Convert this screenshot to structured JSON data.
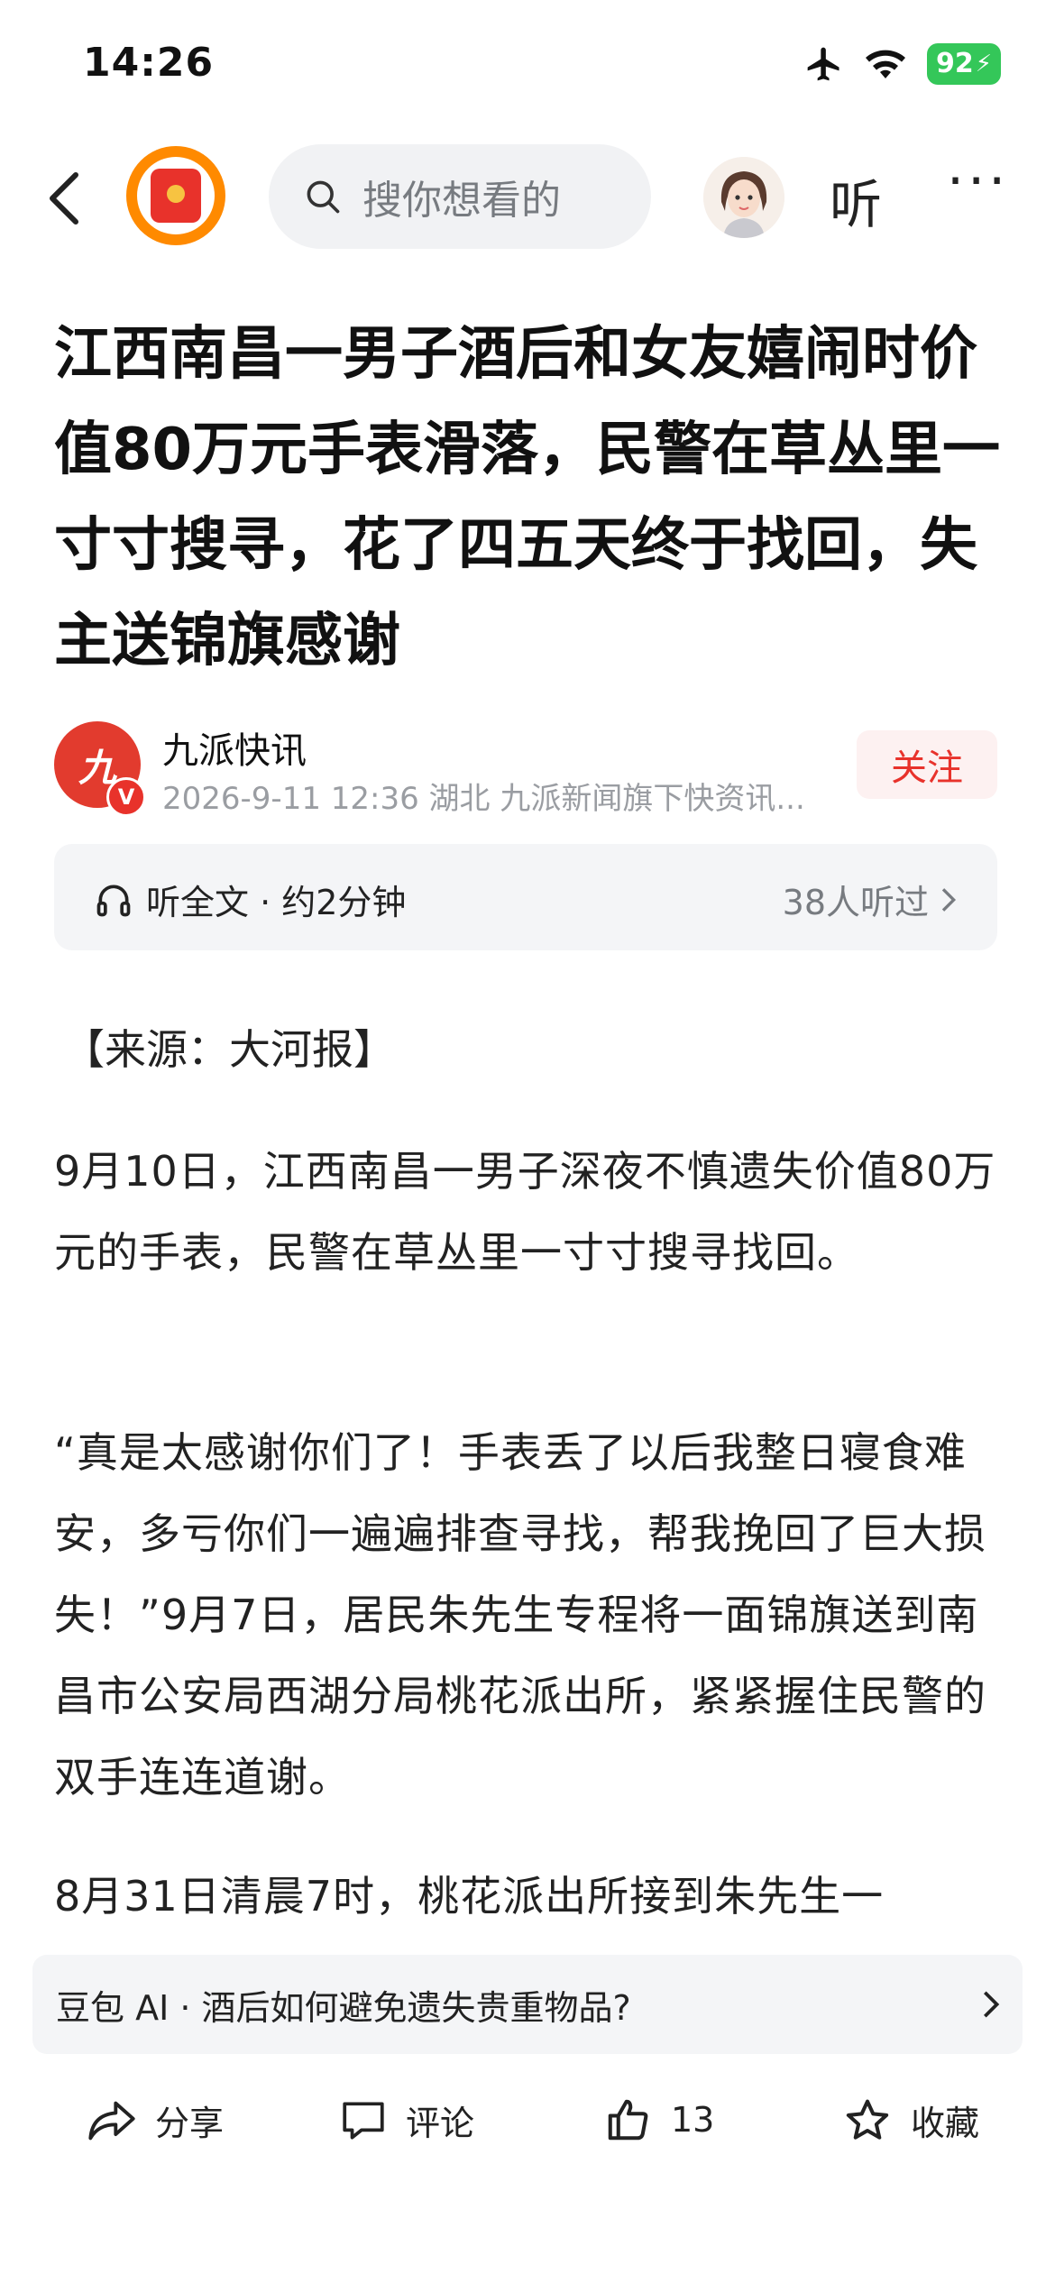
{
  "status_bar": {
    "time": "14:26",
    "battery": "92"
  },
  "nav": {
    "search_placeholder": "搜你想看的",
    "listen_label": "听",
    "more_label": "···"
  },
  "article": {
    "title": "江西南昌一男子酒后和女友嬉闹时价值80万元手表滑落，民警在草丛里一寸寸搜寻，花了四五天终于找回，失主送锦旗感谢",
    "author": {
      "name": "九派快讯",
      "meta": "2026-9-11  12:36  湖北  九派新闻旗下快资讯...",
      "follow_label": "关注"
    },
    "listen_bar": {
      "left_text": "听全文 · 约2分钟",
      "right_text": "38人听过"
    },
    "source": "【来源：大河报】",
    "paragraphs": [
      "9月10日，江西南昌一男子深夜不慎遗失价值80万元的手表，民警在草丛里一寸寸搜寻找回。",
      "“真是太感谢你们了！手表丢了以后我整日寝食难安，多亏你们一遍遍排查寻找，帮我挽回了巨大损失！”9月7日，居民朱先生专程将一面锦旗送到南昌市公安局西湖分局桃花派出所，紧紧握住民警的双手连连道谢。",
      "8月31日清晨7时，桃花派出所接到朱先生一"
    ]
  },
  "ai_bar": {
    "text": "豆包 AI · 酒后如何避免遗失贵重物品?"
  },
  "bottom_bar": {
    "share_label": "分享",
    "comment_label": "评论",
    "like_count": "13",
    "collect_label": "收藏"
  },
  "colors": {
    "accent_red": "#e8322b",
    "battery_green": "#34c759",
    "redpack_orange": "#ff8a00"
  }
}
